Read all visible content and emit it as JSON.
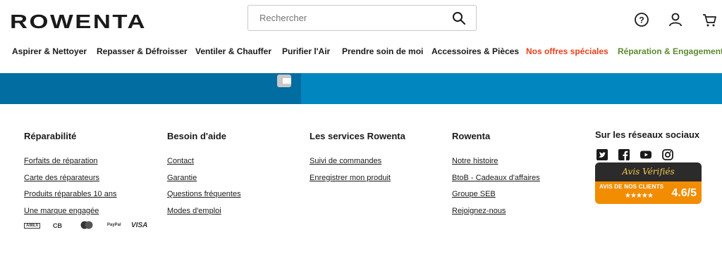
{
  "header": {
    "logo_text": "ROWENTA",
    "search_placeholder": "Rechercher",
    "icons": [
      "help-icon",
      "account-icon",
      "cart-icon"
    ]
  },
  "nav": {
    "items": [
      {
        "label": "Aspirer & Nettoyer",
        "color": "#1a1a1a"
      },
      {
        "label": "Repasser & Défroisser",
        "color": "#1a1a1a"
      },
      {
        "label": "Ventiler & Chauffer",
        "color": "#1a1a1a"
      },
      {
        "label": "Purifier l'Air",
        "color": "#1a1a1a"
      },
      {
        "label": "Prendre soin de moi",
        "color": "#1a1a1a"
      },
      {
        "label": "Accessoires & Pièces",
        "color": "#1a1a1a"
      },
      {
        "label": "Nos offres spéciales",
        "color": "#e8401c"
      },
      {
        "label": "Réparation & Engagement",
        "color": "#5c8a2f"
      }
    ]
  },
  "footer": {
    "columns": [
      {
        "title": "Réparabilité",
        "links": [
          "Forfaits de réparation",
          "Carte des réparateurs",
          "Produits réparables 10 ans",
          "Une marque engagée"
        ]
      },
      {
        "title": "Besoin d'aide",
        "links": [
          "Contact",
          "Garantie",
          "Questions fréquentes",
          "Modes d'emploi"
        ]
      },
      {
        "title": "Les services Rowenta",
        "links": [
          "Suivi de commandes",
          "Enregistrer mon produit"
        ]
      },
      {
        "title": "Rowenta",
        "links": [
          "Notre histoire",
          "BtoB - Cadeaux d'affaires",
          "Groupe SEB",
          "Rejoignez-nous"
        ]
      }
    ],
    "social": {
      "title": "Sur les réseaux sociaux",
      "icons": [
        "twitter-icon",
        "facebook-icon",
        "youtube-icon",
        "instagram-icon"
      ]
    },
    "avis": {
      "brand": "Avis Vérifiés",
      "label": "AVIS DE NOS CLIENTS",
      "stars": "★★★★★",
      "score": "4.6/5"
    },
    "payment": [
      "AMEX",
      "CB",
      "MasterCard",
      "PayPal",
      "VISA"
    ]
  }
}
